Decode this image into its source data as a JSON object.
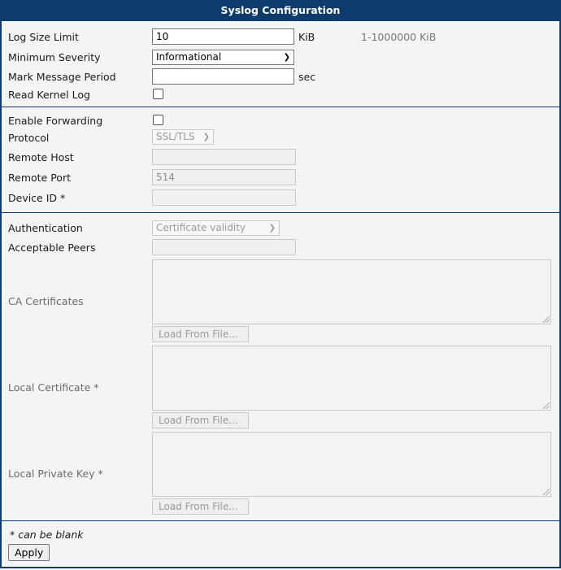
{
  "header": {
    "title": "Syslog Configuration"
  },
  "section1": {
    "log_size": {
      "label": "Log Size Limit",
      "value": "10",
      "unit": "KiB",
      "range": "1-1000000 KiB"
    },
    "min_severity": {
      "label": "Minimum Severity",
      "value": "Informational"
    },
    "mark_period": {
      "label": "Mark Message Period",
      "value": "",
      "unit": "sec"
    },
    "kernel_log": {
      "label": "Read Kernel Log",
      "checked": false
    }
  },
  "section2": {
    "forwarding": {
      "label": "Enable Forwarding",
      "checked": false
    },
    "protocol": {
      "label": "Protocol",
      "value": "SSL/TLS"
    },
    "remote_host": {
      "label": "Remote Host",
      "value": ""
    },
    "remote_port": {
      "label": "Remote Port",
      "value": "514"
    },
    "device_id": {
      "label": "Device ID *",
      "value": ""
    }
  },
  "section3": {
    "authentication": {
      "label": "Authentication",
      "value": "Certificate validity"
    },
    "peers": {
      "label": "Acceptable Peers",
      "value": ""
    },
    "ca_certs": {
      "label": "CA Certificates",
      "button": "Load From File..."
    },
    "local_cert": {
      "label": "Local Certificate *",
      "button": "Load From File..."
    },
    "private_key": {
      "label": "Local Private Key *",
      "button": "Load From File..."
    }
  },
  "footer": {
    "note": "* can be blank",
    "apply": "Apply"
  },
  "colors": {
    "header_bg": "#0d3b6e",
    "panel_bg": "#f4f4f4"
  }
}
